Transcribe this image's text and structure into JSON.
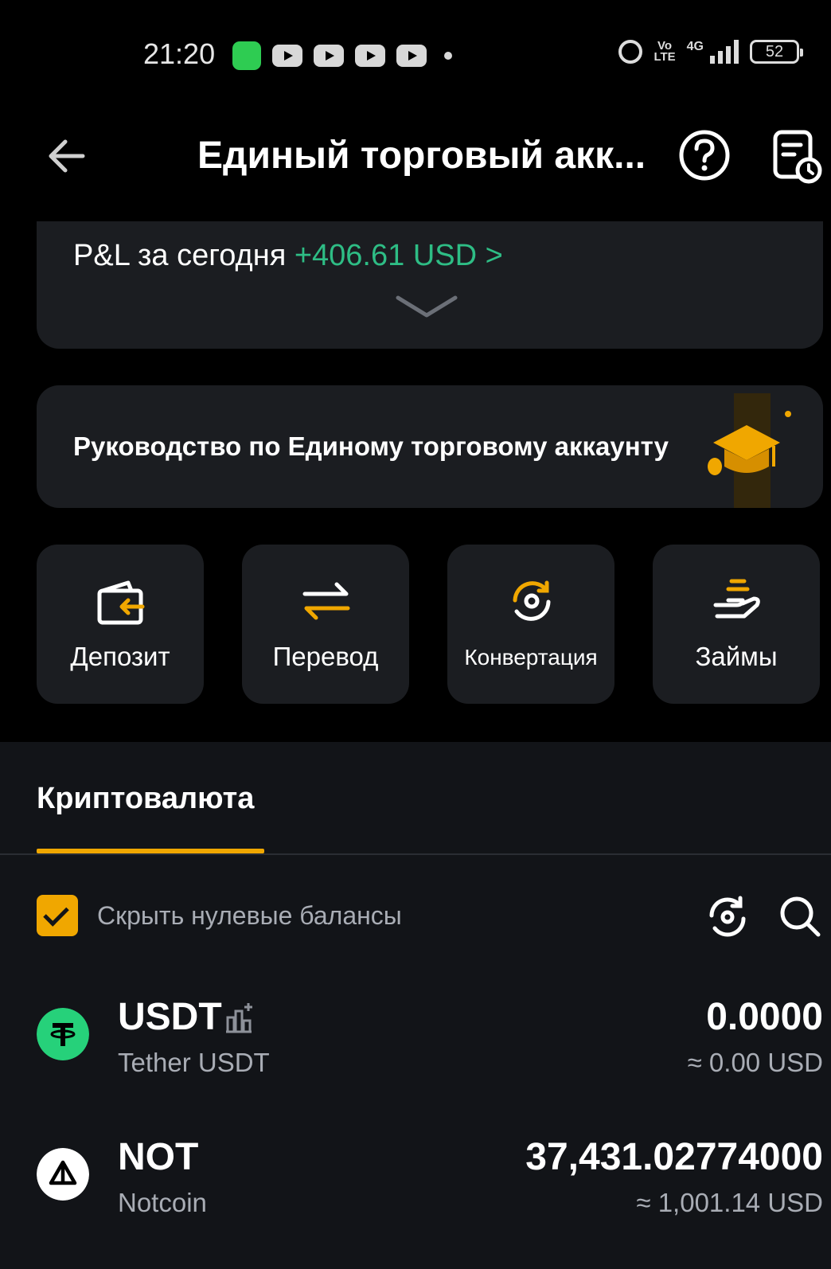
{
  "status_bar": {
    "time": "21:20",
    "battery": "52",
    "network": "4G",
    "volte": "Vo LTE"
  },
  "header": {
    "title": "Единый торговый акк...",
    "icons": [
      "back-arrow-icon",
      "help-icon",
      "history-icon"
    ]
  },
  "pnl": {
    "label": "P&L за сегодня",
    "value": "+406.61 USD",
    "chevron": ">",
    "value_color": "#2ebd85"
  },
  "guide": {
    "text": "Руководство по Единому торговому аккаунту"
  },
  "actions": [
    {
      "label": "Депозит",
      "icon": "deposit-icon"
    },
    {
      "label": "Перевод",
      "icon": "transfer-icon"
    },
    {
      "label": "Конвертация",
      "icon": "convert-icon"
    },
    {
      "label": "Займы",
      "icon": "loans-icon"
    }
  ],
  "tabs": {
    "active": "Криптовалюта"
  },
  "filters": {
    "hide_zero_label": "Скрыть нулевые балансы",
    "hide_zero_checked": true
  },
  "assets": [
    {
      "symbol": "USDT",
      "name": "Tether USDT",
      "amount": "0.0000",
      "usd": "≈ 0.00 USD",
      "logo_color": "#26d17a"
    },
    {
      "symbol": "NOT",
      "name": "Notcoin",
      "amount": "37,431.02774000",
      "usd": "≈ 1,001.14 USD",
      "logo_color": "#ffffff"
    }
  ],
  "colors": {
    "accent": "#f0a700",
    "positive": "#2ebd85",
    "card": "#1b1d21",
    "panel": "#121418"
  }
}
